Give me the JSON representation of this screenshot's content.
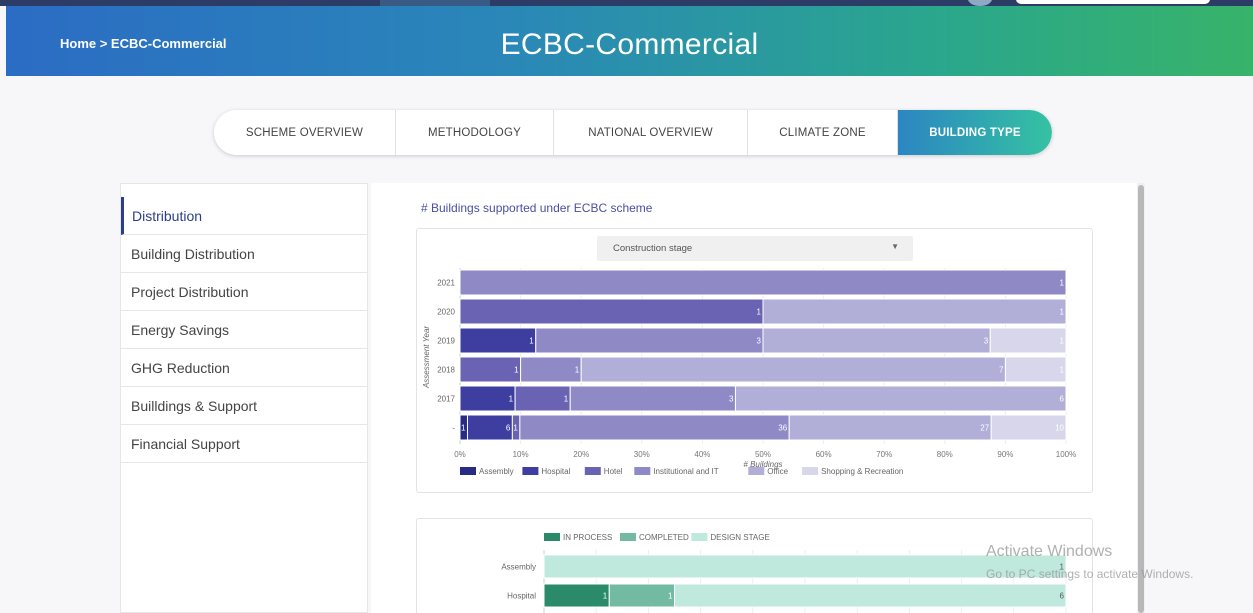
{
  "breadcrumb": "Home > ECBC-Commercial",
  "title": "ECBC-Commercial",
  "tabs": [
    {
      "label": "SCHEME OVERVIEW"
    },
    {
      "label": "METHODOLOGY"
    },
    {
      "label": "NATIONAL OVERVIEW"
    },
    {
      "label": "CLIMATE ZONE"
    },
    {
      "label": "BUILDING TYPE"
    }
  ],
  "active_tab": "BUILDING TYPE",
  "sidebar": {
    "items": [
      {
        "label": "Distribution"
      },
      {
        "label": "Building Distribution"
      },
      {
        "label": "Project Distribution"
      },
      {
        "label": "Energy Savings"
      },
      {
        "label": "GHG Reduction"
      },
      {
        "label": "Builldings & Support"
      },
      {
        "label": "Financial Support"
      }
    ]
  },
  "section_title": "# Buildings supported under ECBC scheme",
  "filter": {
    "selected": "Construction stage"
  },
  "colors": {
    "Assembly": "#262b84",
    "Hospital": "#3e3ea0",
    "Hotel": "#6a63b3",
    "Institutional and IT": "#8f8ac6",
    "Office": "#b1aed8",
    "Shopping & Recreation": "#d7d6ea",
    "IN PROCESS": "#2a8a6a",
    "COMPLETED": "#72baa2",
    "DESIGN STAGE": "#bfe9dd"
  },
  "chart_data": [
    {
      "type": "bar",
      "stacking": "percent",
      "orientation": "horizontal",
      "xlabel": "# Buildings",
      "ylabel": "Assessment Year",
      "xlim": [
        0,
        100
      ],
      "x_ticks": [
        "0%",
        "10%",
        "20%",
        "30%",
        "40%",
        "50%",
        "60%",
        "70%",
        "80%",
        "90%",
        "100%"
      ],
      "categories": [
        "2021",
        "2020",
        "2019",
        "2018",
        "2017",
        "-"
      ],
      "series": [
        {
          "name": "Assembly",
          "values": [
            0,
            0,
            0,
            0,
            0,
            1
          ]
        },
        {
          "name": "Hospital",
          "values": [
            0,
            0,
            1,
            0,
            1,
            6
          ]
        },
        {
          "name": "Hotel",
          "values": [
            0,
            1,
            0,
            1,
            1,
            1
          ]
        },
        {
          "name": "Institutional and IT",
          "values": [
            1,
            0,
            3,
            1,
            3,
            36
          ]
        },
        {
          "name": "Office",
          "values": [
            0,
            1,
            3,
            7,
            6,
            27
          ]
        },
        {
          "name": "Shopping & Recreation",
          "values": [
            0,
            0,
            1,
            1,
            0,
            10
          ]
        }
      ],
      "legend": "bottom",
      "grid": true
    },
    {
      "type": "bar",
      "stacking": "percent",
      "orientation": "horizontal",
      "categories": [
        "Assembly",
        "Hospital"
      ],
      "series": [
        {
          "name": "IN PROCESS",
          "values": [
            0,
            1
          ]
        },
        {
          "name": "COMPLETED",
          "values": [
            0,
            1
          ]
        },
        {
          "name": "DESIGN STAGE",
          "values": [
            1,
            6
          ]
        }
      ],
      "legend": "top"
    }
  ],
  "watermark": {
    "line1": "Activate Windows",
    "line2": "Go to PC settings to activate Windows."
  }
}
